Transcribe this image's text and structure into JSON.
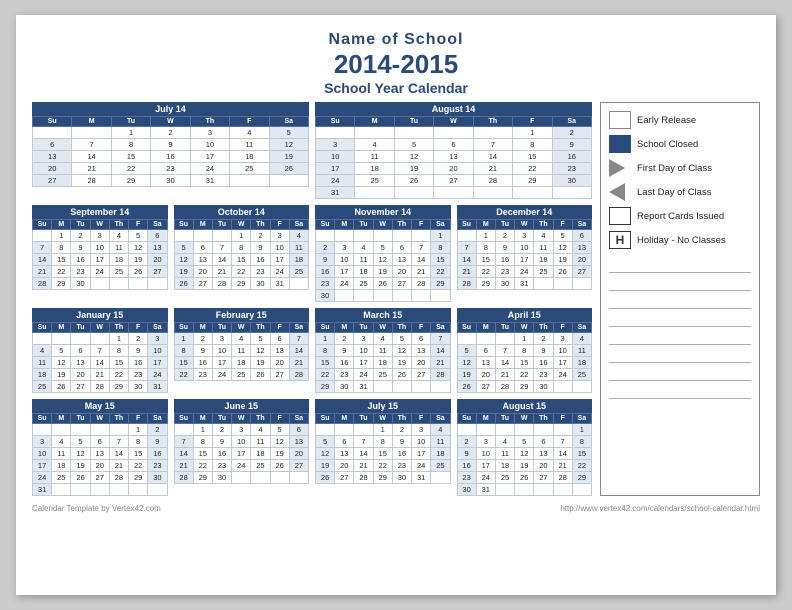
{
  "header": {
    "school_name": "Name of School",
    "year": "2014-2015",
    "subtitle": "School Year Calendar"
  },
  "legend": {
    "items": [
      {
        "id": "early-release",
        "type": "hatch",
        "label": "Early Release"
      },
      {
        "id": "school-closed",
        "type": "solid",
        "label": "School Closed"
      },
      {
        "id": "first-day",
        "type": "triangle-right",
        "label": "First Day of Class"
      },
      {
        "id": "last-day",
        "type": "triangle-left",
        "label": "Last Day of Class"
      },
      {
        "id": "report-cards",
        "type": "square",
        "label": "Report Cards Issued"
      },
      {
        "id": "holiday",
        "type": "h-box",
        "label": "Holiday - No Classes"
      }
    ]
  },
  "calendars": [
    {
      "id": "july14",
      "title": "July 14",
      "days": [
        "Su",
        "M",
        "Tu",
        "W",
        "Th",
        "F",
        "Sa"
      ],
      "weeks": [
        [
          "",
          "",
          "1",
          "2",
          "3",
          "4",
          "5"
        ],
        [
          "6",
          "7",
          "8",
          "9",
          "10",
          "11",
          "12"
        ],
        [
          "13",
          "14",
          "15",
          "16",
          "17",
          "18",
          "19"
        ],
        [
          "20",
          "21",
          "22",
          "23",
          "24",
          "25",
          "26"
        ],
        [
          "27",
          "28",
          "29",
          "30",
          "31",
          "",
          ""
        ]
      ]
    },
    {
      "id": "aug14",
      "title": "August 14",
      "days": [
        "Su",
        "M",
        "Tu",
        "W",
        "Th",
        "F",
        "Sa"
      ],
      "weeks": [
        [
          "",
          "",
          "",
          "",
          "",
          "1",
          "2"
        ],
        [
          "3",
          "4",
          "5",
          "6",
          "7",
          "8",
          "9"
        ],
        [
          "10",
          "11",
          "12",
          "13",
          "14",
          "15",
          "16"
        ],
        [
          "17",
          "18",
          "19",
          "20",
          "21",
          "22",
          "23"
        ],
        [
          "24",
          "25",
          "26",
          "27",
          "28",
          "29",
          "30"
        ],
        [
          "31",
          "",
          "",
          "",
          "",
          "",
          ""
        ]
      ]
    },
    {
      "id": "sep14",
      "title": "September 14",
      "days": [
        "Su",
        "M",
        "Tu",
        "W",
        "Th",
        "F",
        "Sa"
      ],
      "weeks": [
        [
          "",
          "1",
          "2",
          "3",
          "4",
          "5",
          "6"
        ],
        [
          "7",
          "8",
          "9",
          "10",
          "11",
          "12",
          "13"
        ],
        [
          "14",
          "15",
          "16",
          "17",
          "18",
          "19",
          "20"
        ],
        [
          "21",
          "22",
          "23",
          "24",
          "25",
          "26",
          "27"
        ],
        [
          "28",
          "29",
          "30",
          "",
          "",
          "",
          ""
        ]
      ]
    },
    {
      "id": "oct14",
      "title": "October 14",
      "days": [
        "Su",
        "M",
        "Tu",
        "W",
        "Th",
        "F",
        "Sa"
      ],
      "weeks": [
        [
          "",
          "",
          "",
          "1",
          "2",
          "3",
          "4"
        ],
        [
          "5",
          "6",
          "7",
          "8",
          "9",
          "10",
          "11"
        ],
        [
          "12",
          "13",
          "14",
          "15",
          "16",
          "17",
          "18"
        ],
        [
          "19",
          "20",
          "21",
          "22",
          "23",
          "24",
          "25"
        ],
        [
          "26",
          "27",
          "28",
          "29",
          "30",
          "31",
          ""
        ]
      ]
    },
    {
      "id": "nov14",
      "title": "November 14",
      "days": [
        "Su",
        "M",
        "Tu",
        "W",
        "Th",
        "F",
        "Sa"
      ],
      "weeks": [
        [
          "",
          "",
          "",
          "",
          "",
          "",
          "1"
        ],
        [
          "2",
          "3",
          "4",
          "5",
          "6",
          "7",
          "8"
        ],
        [
          "9",
          "10",
          "11",
          "12",
          "13",
          "14",
          "15"
        ],
        [
          "16",
          "17",
          "18",
          "19",
          "20",
          "21",
          "22"
        ],
        [
          "23",
          "24",
          "25",
          "26",
          "27",
          "28",
          "29"
        ],
        [
          "30",
          "",
          "",
          "",
          "",
          "",
          ""
        ]
      ]
    },
    {
      "id": "dec14",
      "title": "December 14",
      "days": [
        "Su",
        "M",
        "Tu",
        "W",
        "Th",
        "F",
        "Sa"
      ],
      "weeks": [
        [
          "",
          "1",
          "2",
          "3",
          "4",
          "5",
          "6"
        ],
        [
          "7",
          "8",
          "9",
          "10",
          "11",
          "12",
          "13"
        ],
        [
          "14",
          "15",
          "16",
          "17",
          "18",
          "19",
          "20"
        ],
        [
          "21",
          "22",
          "23",
          "24",
          "25",
          "26",
          "27"
        ],
        [
          "28",
          "29",
          "30",
          "31",
          "",
          "",
          ""
        ]
      ]
    },
    {
      "id": "jan15",
      "title": "January 15",
      "days": [
        "Su",
        "M",
        "Tu",
        "W",
        "Th",
        "F",
        "Sa"
      ],
      "weeks": [
        [
          "",
          "",
          "",
          "",
          "1",
          "2",
          "3"
        ],
        [
          "4",
          "5",
          "6",
          "7",
          "8",
          "9",
          "10"
        ],
        [
          "11",
          "12",
          "13",
          "14",
          "15",
          "16",
          "17"
        ],
        [
          "18",
          "19",
          "20",
          "21",
          "22",
          "23",
          "24"
        ],
        [
          "25",
          "26",
          "27",
          "28",
          "29",
          "30",
          "31"
        ]
      ]
    },
    {
      "id": "feb15",
      "title": "February 15",
      "days": [
        "Su",
        "M",
        "Tu",
        "W",
        "Th",
        "F",
        "Sa"
      ],
      "weeks": [
        [
          "1",
          "2",
          "3",
          "4",
          "5",
          "6",
          "7"
        ],
        [
          "8",
          "9",
          "10",
          "11",
          "12",
          "13",
          "14"
        ],
        [
          "15",
          "16",
          "17",
          "18",
          "19",
          "20",
          "21"
        ],
        [
          "22",
          "23",
          "24",
          "25",
          "26",
          "27",
          "28"
        ]
      ]
    },
    {
      "id": "mar15",
      "title": "March 15",
      "days": [
        "Su",
        "M",
        "Tu",
        "W",
        "Th",
        "F",
        "Sa"
      ],
      "weeks": [
        [
          "1",
          "2",
          "3",
          "4",
          "5",
          "6",
          "7"
        ],
        [
          "8",
          "9",
          "10",
          "11",
          "12",
          "13",
          "14"
        ],
        [
          "15",
          "16",
          "17",
          "18",
          "19",
          "20",
          "21"
        ],
        [
          "22",
          "23",
          "24",
          "25",
          "26",
          "27",
          "28"
        ],
        [
          "29",
          "30",
          "31",
          "",
          "",
          "",
          ""
        ]
      ]
    },
    {
      "id": "apr15",
      "title": "April 15",
      "days": [
        "Su",
        "M",
        "Tu",
        "W",
        "Th",
        "F",
        "Sa"
      ],
      "weeks": [
        [
          "",
          "",
          "",
          "1",
          "2",
          "3",
          "4"
        ],
        [
          "5",
          "6",
          "7",
          "8",
          "9",
          "10",
          "11"
        ],
        [
          "12",
          "13",
          "14",
          "15",
          "16",
          "17",
          "18"
        ],
        [
          "19",
          "20",
          "21",
          "22",
          "23",
          "24",
          "25"
        ],
        [
          "26",
          "27",
          "28",
          "29",
          "30",
          "",
          ""
        ]
      ]
    },
    {
      "id": "may15",
      "title": "May 15",
      "days": [
        "Su",
        "M",
        "Tu",
        "W",
        "Th",
        "F",
        "Sa"
      ],
      "weeks": [
        [
          "",
          "",
          "",
          "",
          "",
          "1",
          "2"
        ],
        [
          "3",
          "4",
          "5",
          "6",
          "7",
          "8",
          "9"
        ],
        [
          "10",
          "11",
          "12",
          "13",
          "14",
          "15",
          "16"
        ],
        [
          "17",
          "18",
          "19",
          "20",
          "21",
          "22",
          "23"
        ],
        [
          "24",
          "25",
          "26",
          "27",
          "28",
          "29",
          "30"
        ],
        [
          "31",
          "",
          "",
          "",
          "",
          "",
          ""
        ]
      ]
    },
    {
      "id": "jun15",
      "title": "June 15",
      "days": [
        "Su",
        "M",
        "Tu",
        "W",
        "Th",
        "F",
        "Sa"
      ],
      "weeks": [
        [
          "",
          "1",
          "2",
          "3",
          "4",
          "5",
          "6"
        ],
        [
          "7",
          "8",
          "9",
          "10",
          "11",
          "12",
          "13"
        ],
        [
          "14",
          "15",
          "16",
          "17",
          "18",
          "19",
          "20"
        ],
        [
          "21",
          "22",
          "23",
          "24",
          "25",
          "26",
          "27"
        ],
        [
          "28",
          "29",
          "30",
          "",
          "",
          "",
          ""
        ]
      ]
    },
    {
      "id": "jul15",
      "title": "July 15",
      "days": [
        "Su",
        "M",
        "Tu",
        "W",
        "Th",
        "F",
        "Sa"
      ],
      "weeks": [
        [
          "",
          "",
          "",
          "1",
          "2",
          "3",
          "4"
        ],
        [
          "5",
          "6",
          "7",
          "8",
          "9",
          "10",
          "11"
        ],
        [
          "12",
          "13",
          "14",
          "15",
          "16",
          "17",
          "18"
        ],
        [
          "19",
          "20",
          "21",
          "22",
          "23",
          "24",
          "25"
        ],
        [
          "26",
          "27",
          "28",
          "29",
          "30",
          "31",
          ""
        ]
      ]
    },
    {
      "id": "aug15",
      "title": "August 15",
      "days": [
        "Su",
        "M",
        "Tu",
        "W",
        "Th",
        "F",
        "Sa"
      ],
      "weeks": [
        [
          "",
          "",
          "",
          "",
          "",
          "",
          "1"
        ],
        [
          "2",
          "3",
          "4",
          "5",
          "6",
          "7",
          "8"
        ],
        [
          "9",
          "10",
          "11",
          "12",
          "13",
          "14",
          "15"
        ],
        [
          "16",
          "17",
          "18",
          "19",
          "20",
          "21",
          "22"
        ],
        [
          "23",
          "24",
          "25",
          "26",
          "27",
          "28",
          "29"
        ],
        [
          "30",
          "31",
          "",
          "",
          "",
          "",
          ""
        ]
      ]
    }
  ],
  "footer": {
    "left": "Calendar Template by Vertex42.com",
    "right": "http://www.vertex42.com/calendars/school-calendar.html"
  }
}
